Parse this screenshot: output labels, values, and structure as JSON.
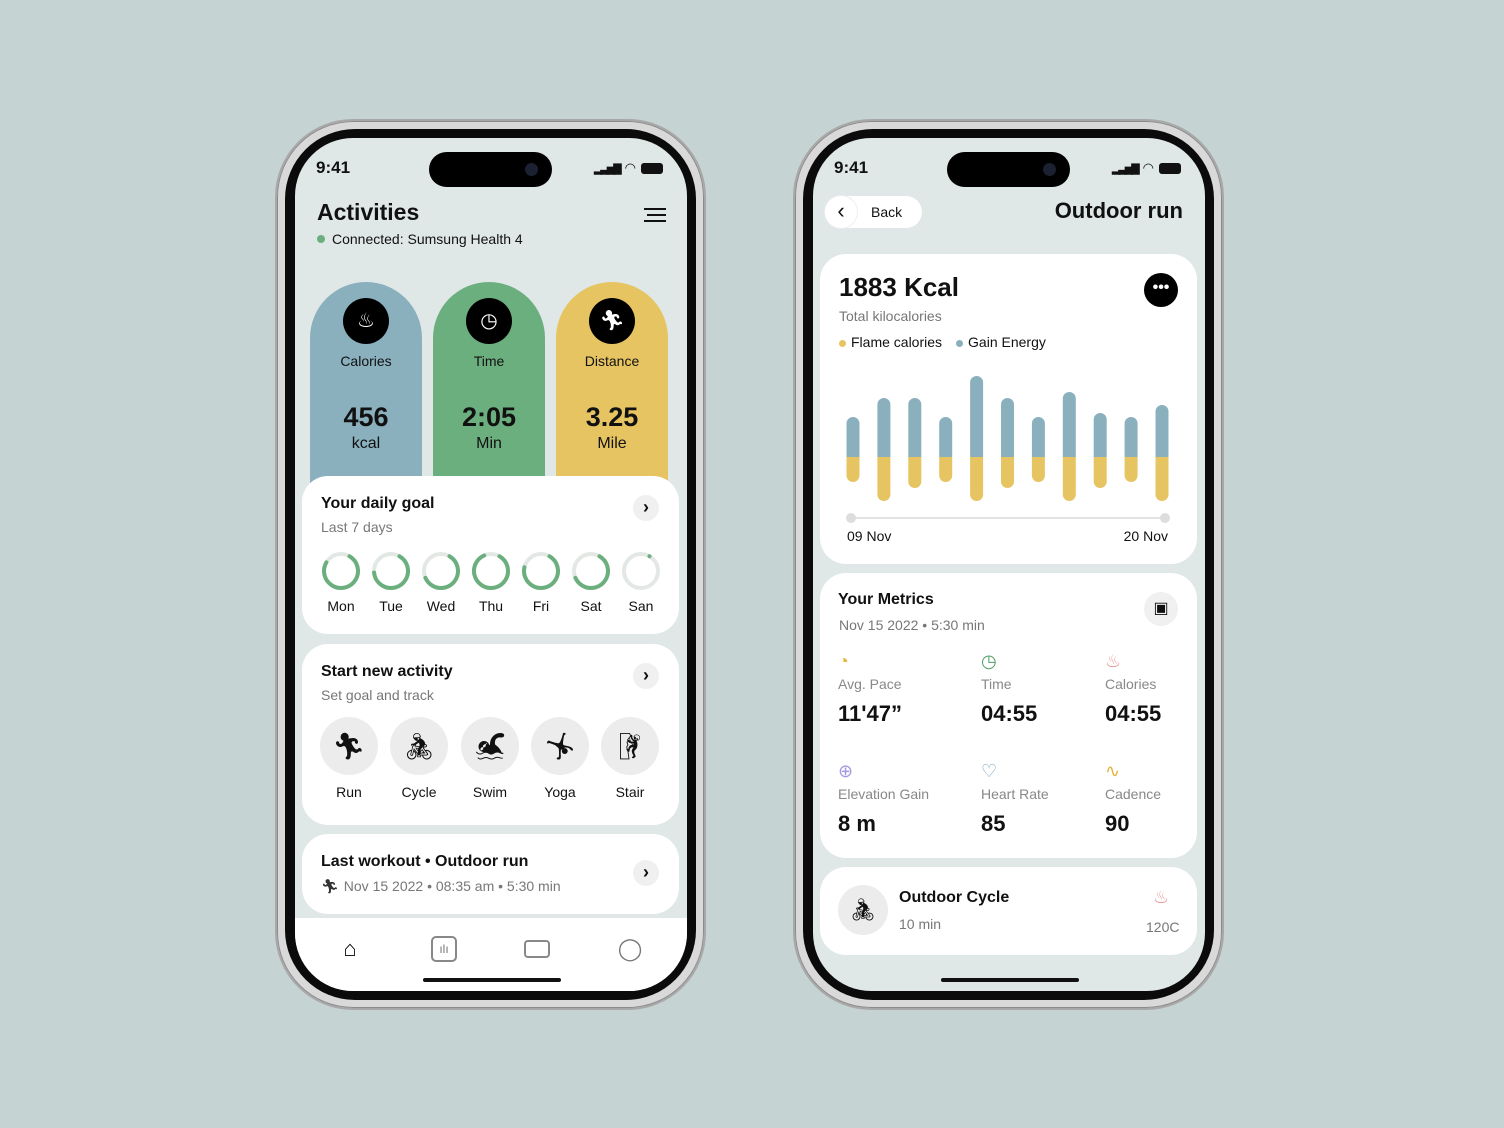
{
  "status_time": "9:41",
  "activities": {
    "title": "Activities",
    "connected": "Connected: Sumsung Health 4",
    "stats": [
      {
        "label": "Calories",
        "value": "456",
        "unit": "kcal",
        "icon": "flame-icon",
        "color": "#8ab0be"
      },
      {
        "label": "Time",
        "value": "2:05",
        "unit": "Min",
        "icon": "clock-icon",
        "color": "#6caf7e"
      },
      {
        "label": "Distance",
        "value": "3.25",
        "unit": "Mile",
        "icon": "runner-icon",
        "color": "#e7c462"
      }
    ],
    "daily_goal": {
      "title": "Your daily goal",
      "subtitle": "Last 7 days",
      "days": [
        {
          "label": "Mon",
          "progress": 0.75
        },
        {
          "label": "Tue",
          "progress": 0.65
        },
        {
          "label": "Wed",
          "progress": 0.6
        },
        {
          "label": "Thu",
          "progress": 0.85
        },
        {
          "label": "Fri",
          "progress": 0.7
        },
        {
          "label": "Sat",
          "progress": 0.6
        },
        {
          "label": "San",
          "progress": 0
        }
      ]
    },
    "new_activity": {
      "title": "Start new activity",
      "subtitle": "Set goal and track",
      "items": [
        {
          "label": "Run",
          "icon": "run-icon"
        },
        {
          "label": "Cycle",
          "icon": "cycle-icon"
        },
        {
          "label": "Swim",
          "icon": "swim-icon"
        },
        {
          "label": "Yoga",
          "icon": "yoga-icon"
        },
        {
          "label": "Stair",
          "icon": "stair-icon"
        }
      ]
    },
    "last_workout": {
      "title": "Last workout • Outdoor run",
      "details": "Nov 15 2022 • 08:35 am • 5:30 min"
    },
    "tabs": [
      "home-icon",
      "stats-icon",
      "card-icon",
      "profile-icon"
    ]
  },
  "outdoor": {
    "back": "Back",
    "title": "Outdoor run",
    "kcal": "1883 Kcal",
    "kcal_sub": "Total kilocalories",
    "legend": [
      {
        "name": "Flame calories",
        "color": "#e7c462"
      },
      {
        "name": "Gain Energy",
        "color": "#8ab0be"
      }
    ],
    "chart_data": {
      "type": "bar",
      "x_start": "09 Nov",
      "x_end": "20 Nov",
      "series": [
        {
          "name": "Gain Energy",
          "color": "#8ab0be",
          "values": [
            40,
            59,
            59,
            40,
            81,
            59,
            40,
            65,
            44,
            40,
            52
          ]
        },
        {
          "name": "Flame calories",
          "color": "#e7c462",
          "values": [
            25,
            44,
            31,
            25,
            44,
            31,
            25,
            44,
            31,
            25,
            44
          ]
        }
      ]
    },
    "metrics": {
      "title": "Your Metrics",
      "subtitle": "Nov 15 2022 • 5:30 min",
      "items": [
        {
          "label": "Avg. Pace",
          "value": "11'47”",
          "icon": "pace-icon",
          "color": "#e2b63d"
        },
        {
          "label": "Time",
          "value": "04:55",
          "icon": "clock-icon",
          "color": "#4e9e62"
        },
        {
          "label": "Calories",
          "value": "04:55",
          "icon": "flame-icon",
          "color": "#e79a98"
        },
        {
          "label": "Elevation Gain",
          "value": "8 m",
          "icon": "elevation-icon",
          "color": "#a59ae0"
        },
        {
          "label": "Heart Rate",
          "value": "85",
          "icon": "heart-icon",
          "color": "#7aa9bd"
        },
        {
          "label": "Cadence",
          "value": "90",
          "icon": "cadence-icon",
          "color": "#e2b63d"
        }
      ]
    },
    "cycle": {
      "title": "Outdoor Cycle",
      "duration": "10 min",
      "calories": "120C"
    }
  }
}
